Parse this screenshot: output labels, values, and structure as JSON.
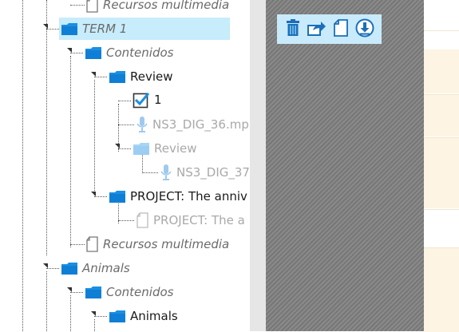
{
  "tree": {
    "items": [
      {
        "label": "Recursos multimedia",
        "icon": "file-icon",
        "style": "italic"
      },
      {
        "label": "TERM 1",
        "icon": "folder-icon",
        "style": "italic",
        "selected": true
      },
      {
        "label": "Contenidos",
        "icon": "folder-icon",
        "style": "italic"
      },
      {
        "label": "Review",
        "icon": "folder-icon",
        "style": "normal"
      },
      {
        "label": "1",
        "icon": "checkbox-icon",
        "style": "normal"
      },
      {
        "label": "NS3_DIG_36.mp",
        "icon": "microphone-icon",
        "style": "faded"
      },
      {
        "label": "Review",
        "icon": "folder-icon",
        "style": "faded"
      },
      {
        "label": "NS3_DIG_37",
        "icon": "microphone-icon",
        "style": "faded"
      },
      {
        "label": "PROJECT: The anniv",
        "icon": "folder-icon",
        "style": "normal"
      },
      {
        "label": "PROJECT: The a",
        "icon": "file-icon",
        "style": "faded"
      },
      {
        "label": "Recursos multimedia",
        "icon": "file-icon",
        "style": "italic"
      },
      {
        "label": "Animals",
        "icon": "folder-icon",
        "style": "italic"
      },
      {
        "label": "Contenidos",
        "icon": "folder-icon",
        "style": "italic"
      },
      {
        "label": "Animals",
        "icon": "folder-icon",
        "style": "normal"
      }
    ]
  },
  "toolbar": {
    "buttons": [
      {
        "name": "trash-icon"
      },
      {
        "name": "share-icon"
      },
      {
        "name": "document-icon"
      },
      {
        "name": "download-icon"
      }
    ]
  },
  "panel": {
    "collapse_glyph": "‹"
  },
  "colors": {
    "selection": "#c7ecfb",
    "toolbar": "#c9eafa",
    "folder": "#1a8fe3",
    "hatch": "#808080",
    "cream": "#fdf4e3"
  }
}
